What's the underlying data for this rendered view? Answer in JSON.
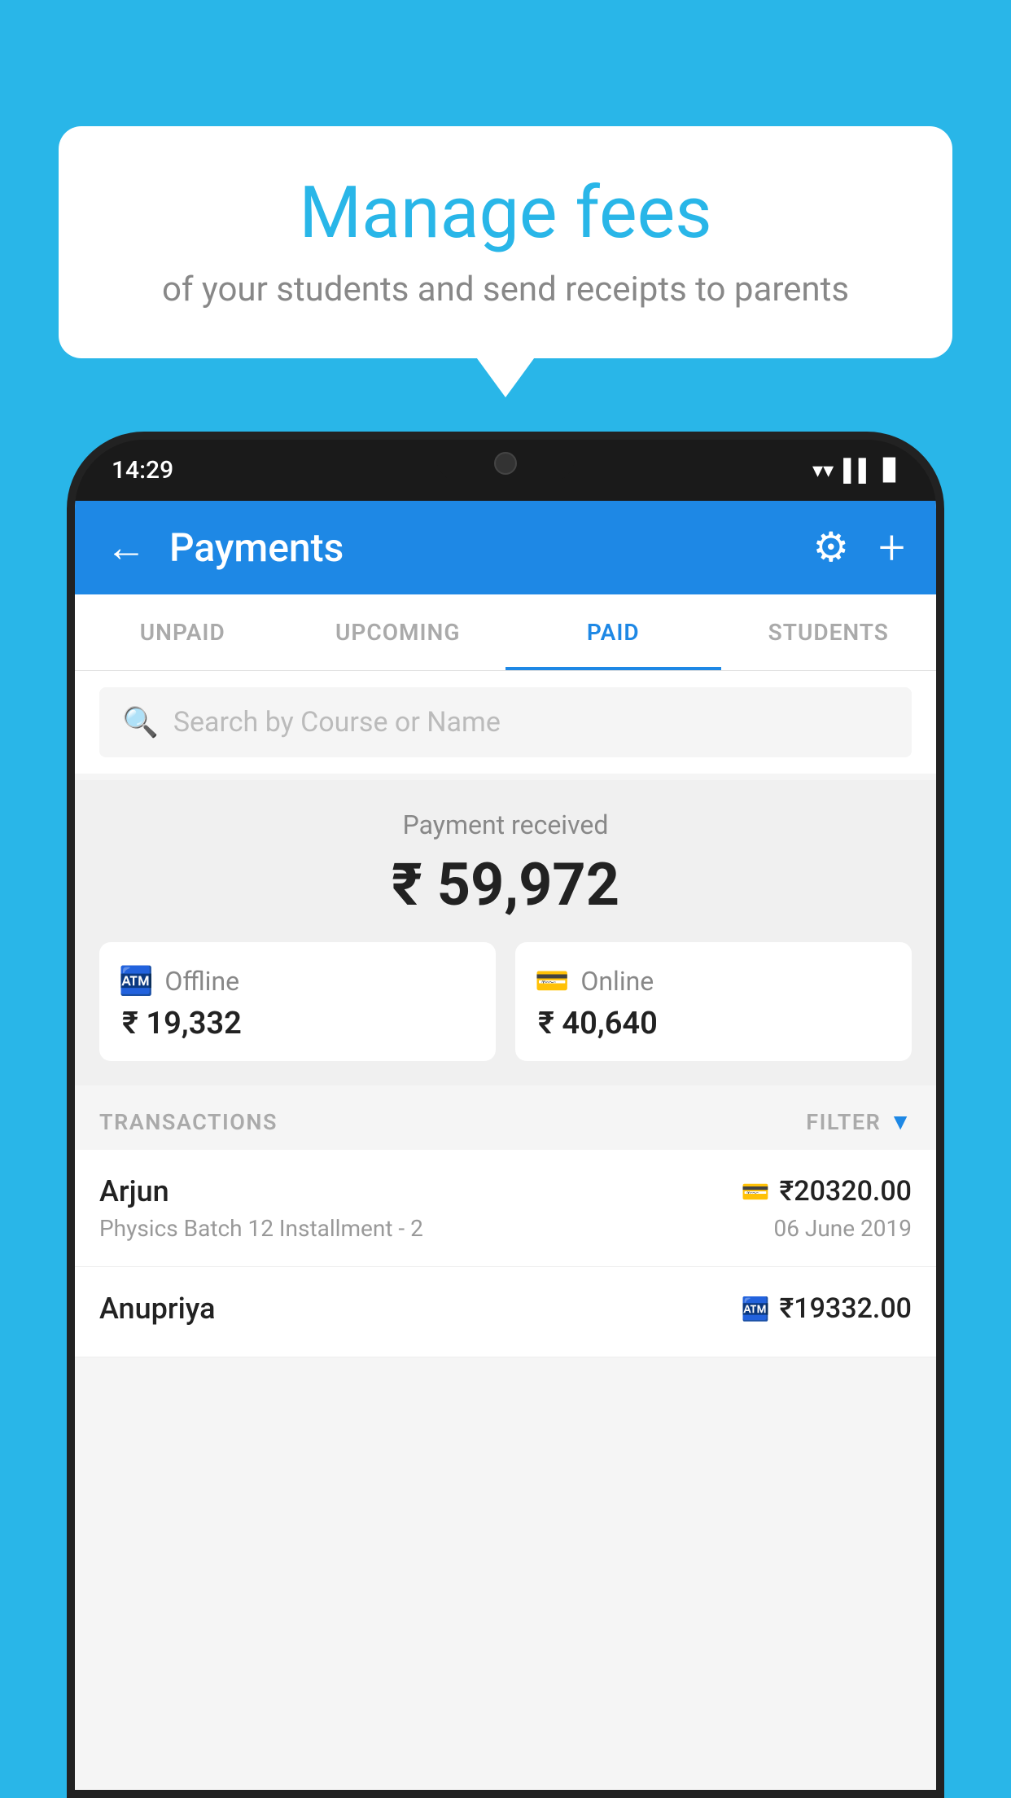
{
  "background_color": "#29b6e8",
  "bubble": {
    "title": "Manage fees",
    "subtitle": "of your students and send receipts to parents"
  },
  "status_bar": {
    "time": "14:29",
    "icons": [
      "▲▲",
      "▌▌",
      "▊"
    ]
  },
  "app_bar": {
    "title": "Payments",
    "back_label": "←",
    "settings_label": "⚙",
    "add_label": "+"
  },
  "tabs": [
    {
      "label": "UNPAID",
      "active": false
    },
    {
      "label": "UPCOMING",
      "active": false
    },
    {
      "label": "PAID",
      "active": true
    },
    {
      "label": "STUDENTS",
      "active": false
    }
  ],
  "search": {
    "placeholder": "Search by Course or Name"
  },
  "payment": {
    "label": "Payment received",
    "amount": "₹ 59,972",
    "offline": {
      "type": "Offline",
      "amount": "₹ 19,332",
      "icon": "💳"
    },
    "online": {
      "type": "Online",
      "amount": "₹ 40,640",
      "icon": "💳"
    }
  },
  "transactions": {
    "label": "TRANSACTIONS",
    "filter_label": "FILTER",
    "rows": [
      {
        "name": "Arjun",
        "course": "Physics Batch 12 Installment - 2",
        "amount": "₹20320.00",
        "date": "06 June 2019",
        "payment_type": "card"
      },
      {
        "name": "Anupriya",
        "course": "",
        "amount": "₹19332.00",
        "date": "",
        "payment_type": "cash"
      }
    ]
  }
}
